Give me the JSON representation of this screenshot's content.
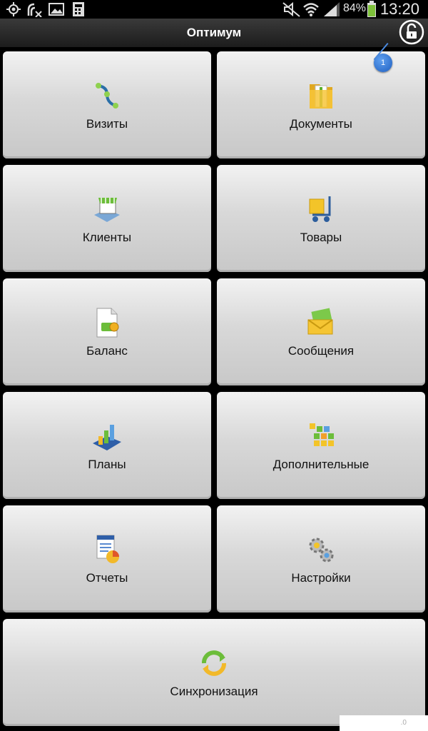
{
  "status_bar": {
    "battery": "84%",
    "time": "13:20"
  },
  "header": {
    "title": "Оптимум",
    "notification_count": "1"
  },
  "menu": [
    {
      "label": "Визиты",
      "icon": "visits-icon"
    },
    {
      "label": "Документы",
      "icon": "documents-folder-icon"
    },
    {
      "label": "Клиенты",
      "icon": "clients-store-icon"
    },
    {
      "label": "Товары",
      "icon": "goods-cart-icon"
    },
    {
      "label": "Баланс",
      "icon": "balance-icon"
    },
    {
      "label": "Сообщения",
      "icon": "messages-envelope-icon"
    },
    {
      "label": "Планы",
      "icon": "plans-chart-icon"
    },
    {
      "label": "Дополнительные",
      "icon": "additional-grid-icon"
    },
    {
      "label": "Отчеты",
      "icon": "reports-icon"
    },
    {
      "label": "Настройки",
      "icon": "settings-gears-icon"
    },
    {
      "label": "Синхронизация",
      "icon": "sync-icon"
    }
  ],
  "corner_text": ".0"
}
